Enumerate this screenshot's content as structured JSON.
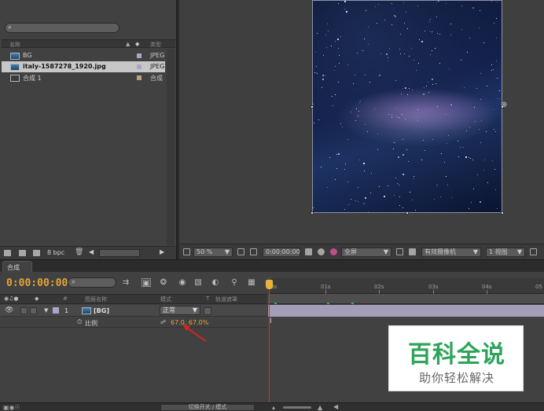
{
  "project": {
    "search_placeholder": "",
    "columns": {
      "name": "名称",
      "type": "类型"
    },
    "items": [
      {
        "name": "BG",
        "type": "JPEG",
        "label_color": "#a9a6c8",
        "selected": false
      },
      {
        "name": "italy-1587278_1920.jpg",
        "type": "JPEG",
        "label_color": "#a9a6c8",
        "selected": true
      },
      {
        "name": "合成 1",
        "type": "合成",
        "label_color": "#bba27a",
        "selected": false
      }
    ],
    "bpc": "8 bpc"
  },
  "viewer": {
    "zoom": "50 %",
    "timecode": "0:00:00:00",
    "resolution": "全屏",
    "camera": "有效摄像机",
    "views": "1 视图"
  },
  "timeline": {
    "tab": "合成 1",
    "timecode": "0:00:00:00",
    "columns": {
      "source_name": "图层名称",
      "mode": "模式",
      "trkmat": "T",
      "parent": "轨道遮罩"
    },
    "layer": {
      "index": "1",
      "name": "[BG]",
      "mode": "正常"
    },
    "property": {
      "name": "比例",
      "value": "67.0, 67.0%"
    },
    "ruler_ticks": [
      "0s",
      "01s",
      "02s",
      "03s",
      "04s",
      "05"
    ],
    "toggle_label": "切换开关 / 模式",
    "accent": "#e5a533",
    "playhead_color": "#c53a2e"
  },
  "watermark": {
    "title": "百科全说",
    "subtitle": "助你轻松解决"
  }
}
